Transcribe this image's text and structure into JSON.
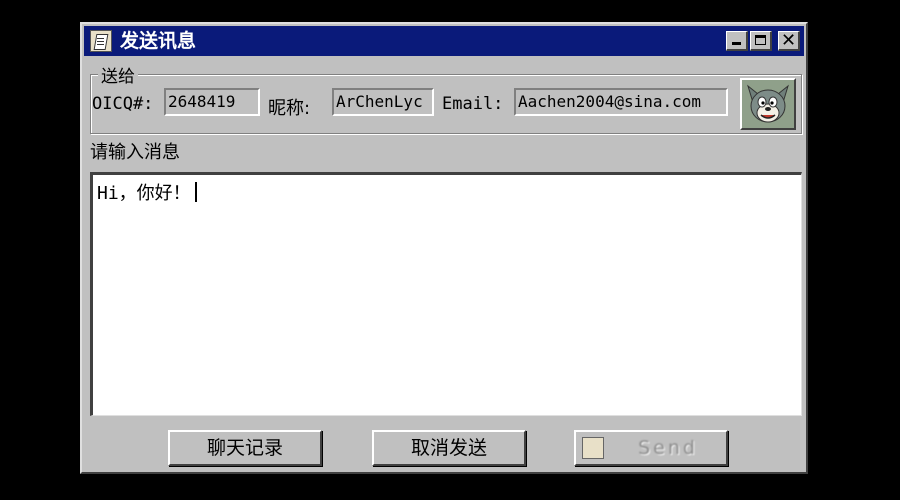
{
  "window": {
    "title": "发送讯息"
  },
  "titlebar_buttons": {
    "minimize": "minimize",
    "maximize": "maximize",
    "close": "close",
    "close_glyph": "✕"
  },
  "send_to": {
    "group_label": "送给",
    "oicq_label": "OICQ#:",
    "oicq_value": "2648419",
    "nickname_label": "昵称:",
    "nickname_value": "ArChenLyc",
    "email_label": "Email:",
    "email_value": "Aachen2004@sina.com",
    "avatar_icon": "tom-cat-avatar-icon"
  },
  "message": {
    "prompt": "请输入消息",
    "text": "Hi，你好！"
  },
  "buttons": {
    "history": "聊天记录",
    "cancel": "取消发送",
    "send": "Send"
  },
  "colors": {
    "titlebar": "#0a1a7a",
    "face": "#c0c0c0"
  }
}
